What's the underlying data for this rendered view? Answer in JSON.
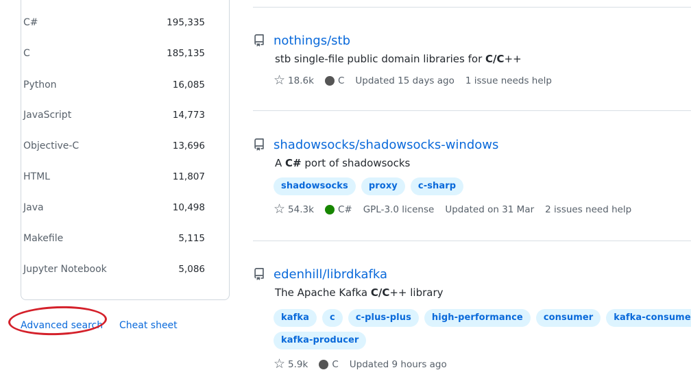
{
  "languages": [
    {
      "name": "C#",
      "count": "195,335"
    },
    {
      "name": "C",
      "count": "185,135"
    },
    {
      "name": "Python",
      "count": "16,085"
    },
    {
      "name": "JavaScript",
      "count": "14,773"
    },
    {
      "name": "Objective-C",
      "count": "13,696"
    },
    {
      "name": "HTML",
      "count": "11,807"
    },
    {
      "name": "Java",
      "count": "10,498"
    },
    {
      "name": "Makefile",
      "count": "5,115"
    },
    {
      "name": "Jupyter Notebook",
      "count": "5,086"
    }
  ],
  "footer": {
    "advanced_search": "Advanced search",
    "cheat_sheet": "Cheat sheet"
  },
  "results": [
    {
      "repo": "nothings/stb",
      "desc_pre": "stb single-file public domain libraries for ",
      "desc_bold": "C/C",
      "desc_post": "++",
      "stars": "18.6k",
      "lang": "C",
      "lang_color": "#555555",
      "updated": "Updated 15 days ago",
      "issues": "1 issue needs help"
    },
    {
      "repo": "shadowsocks/shadowsocks-windows",
      "desc_pre": "A ",
      "desc_bold": "C#",
      "desc_post": " port of shadowsocks",
      "topics": [
        "shadowsocks",
        "proxy",
        "c-sharp"
      ],
      "stars": "54.3k",
      "lang": "C#",
      "lang_color": "#178600",
      "license": "GPL-3.0 license",
      "updated": "Updated on 31 Mar",
      "issues": "2 issues need help"
    },
    {
      "repo": "edenhill/librdkafka",
      "desc_pre": "The Apache Kafka ",
      "desc_bold": "C/C",
      "desc_post": "++ library",
      "topics_row1": [
        "kafka",
        "c",
        "c-plus-plus",
        "high-performance",
        "consumer",
        "kafka-consumer"
      ],
      "topics_row2": [
        "kafka-producer"
      ],
      "stars": "5.9k",
      "lang": "C",
      "lang_color": "#555555",
      "updated": "Updated 9 hours ago"
    }
  ]
}
